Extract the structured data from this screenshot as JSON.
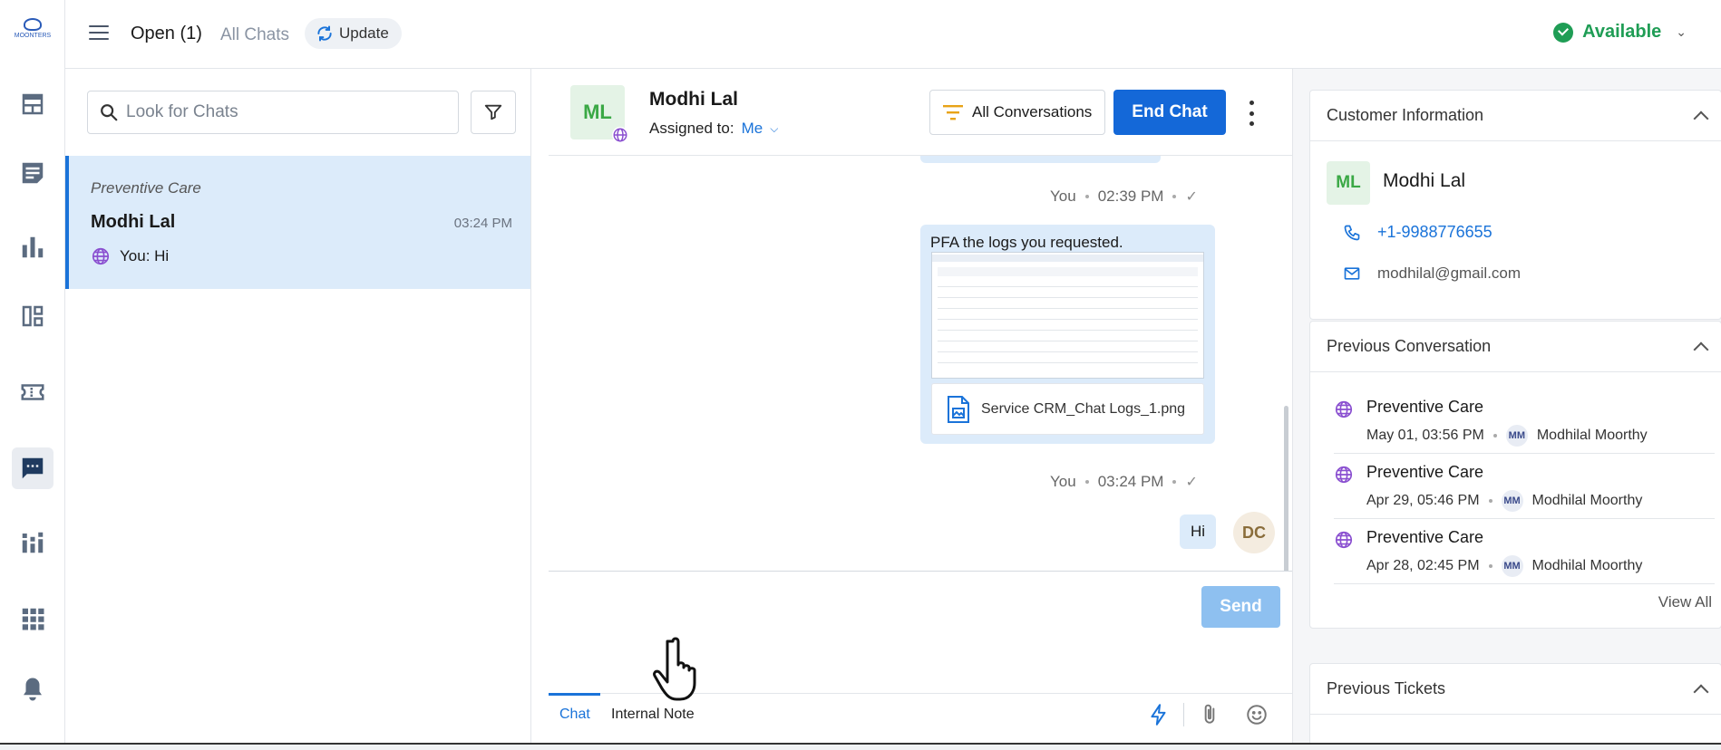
{
  "rail": {
    "logo_text": "MOONTERS",
    "items": [
      {
        "name": "table-icon"
      },
      {
        "name": "notes-icon"
      },
      {
        "name": "bar-chart-icon"
      },
      {
        "name": "dashboard-icon"
      },
      {
        "name": "ticket-icon"
      },
      {
        "name": "chat-icon",
        "active": true
      },
      {
        "name": "reports-icon"
      },
      {
        "name": "apps-grid-icon"
      },
      {
        "name": "bell-icon"
      }
    ]
  },
  "topbar": {
    "tab_open": "Open (1)",
    "tab_all": "All Chats",
    "update_label": "Update",
    "status_label": "Available",
    "status_color": "#1f9d55"
  },
  "chat_list": {
    "search_placeholder": "Look for Chats",
    "items": [
      {
        "category": "Preventive Care",
        "name": "Modhi Lal",
        "time": "03:24 PM",
        "preview": "You: Hi"
      }
    ]
  },
  "conversation": {
    "avatar_initials": "ML",
    "name": "Modhi Lal",
    "assigned_label": "Assigned to:",
    "assigned_value": "Me",
    "all_conversations_label": "All Conversations",
    "end_chat_label": "End Chat",
    "messages": [
      {
        "sender": "You",
        "time": "02:39 PM",
        "text": "PFA the logs you requested.",
        "file_name": "Service CRM_Chat Logs_1.png"
      },
      {
        "sender": "You",
        "time": "03:24 PM",
        "text": "Hi",
        "avatar": "DC"
      }
    ],
    "composer": {
      "send_label": "Send",
      "tabs": [
        "Chat",
        "Internal Note"
      ]
    }
  },
  "customer_info": {
    "title": "Customer Information",
    "initials": "ML",
    "name": "Modhi Lal",
    "phone": "+1-9988776655",
    "email": "modhilal@gmail.com"
  },
  "previous_conversation": {
    "title": "Previous Conversation",
    "items": [
      {
        "title": "Preventive Care",
        "date": "May 01, 03:56 PM",
        "agent_initials": "MM",
        "agent": "Modhilal Moorthy"
      },
      {
        "title": "Preventive Care",
        "date": "Apr 29, 05:46 PM",
        "agent_initials": "MM",
        "agent": "Modhilal Moorthy"
      },
      {
        "title": "Preventive Care",
        "date": "Apr 28, 02:45 PM",
        "agent_initials": "MM",
        "agent": "Modhilal Moorthy"
      }
    ],
    "view_all": "View All"
  },
  "previous_tickets": {
    "title": "Previous Tickets"
  }
}
